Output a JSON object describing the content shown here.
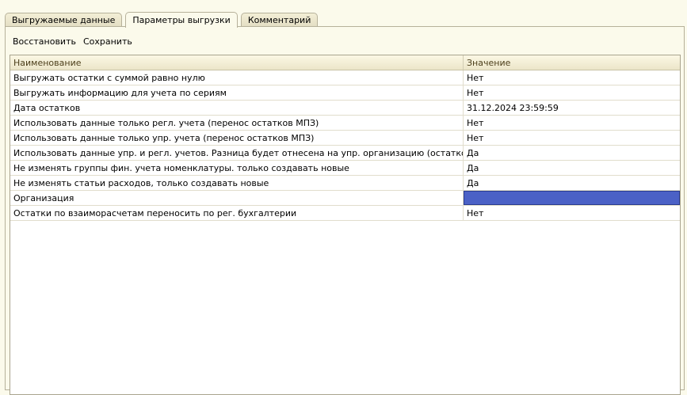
{
  "tabs": [
    {
      "label": "Выгружаемые данные",
      "active": false
    },
    {
      "label": "Параметры выгрузки",
      "active": true
    },
    {
      "label": "Комментарий",
      "active": false
    }
  ],
  "toolbar": {
    "restore_label": "Восстановить",
    "save_label": "Сохранить"
  },
  "table": {
    "columns": [
      "Наименование",
      "Значение"
    ],
    "rows": [
      {
        "name": "Выгружать остатки с суммой равно нулю",
        "value": "Нет"
      },
      {
        "name": "Выгружать информацию для учета по сериям",
        "value": "Нет"
      },
      {
        "name": "Дата остатков",
        "value": "31.12.2024 23:59:59"
      },
      {
        "name": "Использовать данные только регл. учета (перенос остатков МПЗ)",
        "value": "Нет"
      },
      {
        "name": "Использовать данные только упр. учета (перенос остатков МПЗ)",
        "value": "Нет"
      },
      {
        "name": "Использовать данные упр. и регл. учетов. Разница будет отнесена на упр. организацию (остатков МПЗ)",
        "value": "Да"
      },
      {
        "name": "Не изменять группы фин. учета номенклатуры. только создавать новые",
        "value": "Да"
      },
      {
        "name": "Не изменять статьи расходов, только создавать новые",
        "value": "Да"
      },
      {
        "name": "Организация",
        "value": ""
      },
      {
        "name": "Остатки по взаиморасчетам переносить по рег. бухгалтерии",
        "value": "Нет"
      }
    ],
    "selected_row": 8
  }
}
